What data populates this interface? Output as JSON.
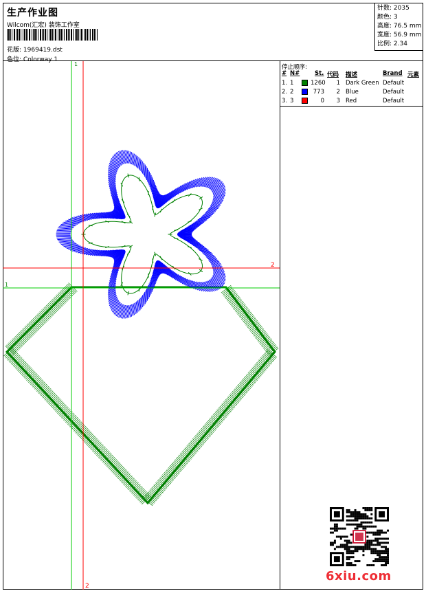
{
  "header": {
    "title": "生产作业图",
    "subtitle": "Wilcom(汇宏) 装饰工作室",
    "pattern_label": "花版:",
    "pattern_value": "1969419.dst",
    "colorway_label": "色位:",
    "colorway_value": "Colorway 1"
  },
  "stats": [
    {
      "label": "针数:",
      "value": "2035"
    },
    {
      "label": "颜色:",
      "value": "3"
    },
    {
      "label": "高度:",
      "value": "76.5 mm"
    },
    {
      "label": "宽度:",
      "value": "56.9 mm"
    },
    {
      "label": "比例:",
      "value": "2.34"
    }
  ],
  "stop_sequence": {
    "title": "停止顺序:",
    "columns": [
      "#",
      "N#",
      "St.",
      "代码",
      "描述",
      "Brand",
      "元素"
    ],
    "rows": [
      {
        "idx": "1.",
        "n": "1",
        "color": "#008000",
        "stitches": "1260",
        "code": "1",
        "desc": "Dark Green",
        "brand": "Default"
      },
      {
        "idx": "2.",
        "n": "2",
        "color": "#0000ff",
        "stitches": "773",
        "code": "2",
        "desc": "Blue",
        "brand": "Default"
      },
      {
        "idx": "3.",
        "n": "3",
        "color": "#ff0000",
        "stitches": "0",
        "code": "3",
        "desc": "Red",
        "brand": "Default"
      }
    ]
  },
  "guides": {
    "green_v_label": "1",
    "green_h_label": "1",
    "red_v_label": "2",
    "red_h_label": "2"
  },
  "watermark": "6xiu.com",
  "colors": {
    "green": "#008000",
    "blue": "#0000ff",
    "red": "#ff0000",
    "brand_red": "#ee2e35"
  }
}
